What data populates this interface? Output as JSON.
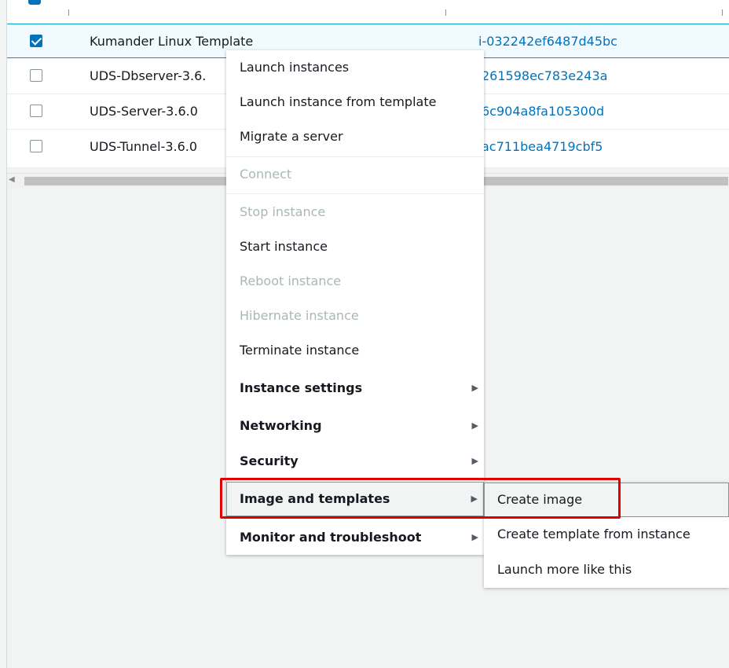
{
  "table": {
    "rows": [
      {
        "name": "Kumander Linux Template",
        "id": "i-032242ef6487d45bc",
        "checked": true
      },
      {
        "name": "UDS-Dbserver-3.6.",
        "id": "261598ec783e243a",
        "checked": false
      },
      {
        "name": "UDS-Server-3.6.0",
        "id": "6c904a8fa105300d",
        "checked": false
      },
      {
        "name": "UDS-Tunnel-3.6.0",
        "id": "ac711bea4719cbf5",
        "checked": false
      }
    ]
  },
  "context_menu": {
    "items": [
      {
        "label": "Launch instances",
        "disabled": false
      },
      {
        "label": "Launch instance from template",
        "disabled": false
      },
      {
        "label": "Migrate a server",
        "disabled": false
      },
      {
        "label": "Connect",
        "disabled": true
      },
      {
        "label": "Stop instance",
        "disabled": true
      },
      {
        "label": "Start instance",
        "disabled": false
      },
      {
        "label": "Reboot instance",
        "disabled": true
      },
      {
        "label": "Hibernate instance",
        "disabled": true
      },
      {
        "label": "Terminate instance",
        "disabled": false
      },
      {
        "label": "Instance settings",
        "submenu": true
      },
      {
        "label": "Networking",
        "submenu": true
      },
      {
        "label": "Security",
        "submenu": true
      },
      {
        "label": "Image and templates",
        "submenu": true,
        "highlighted": true
      },
      {
        "label": "Monitor and troubleshoot",
        "submenu": true
      }
    ]
  },
  "submenu": {
    "items": [
      {
        "label": "Create image",
        "active": true
      },
      {
        "label": "Create template from instance"
      },
      {
        "label": "Launch more like this"
      }
    ]
  },
  "icons": {
    "submenu_arrow": "triangle-right-icon",
    "check": "checkmark-icon"
  },
  "colors": {
    "accent": "#0073bb",
    "highlight_box": "#e00000",
    "disabled_text": "#aab7b8"
  }
}
